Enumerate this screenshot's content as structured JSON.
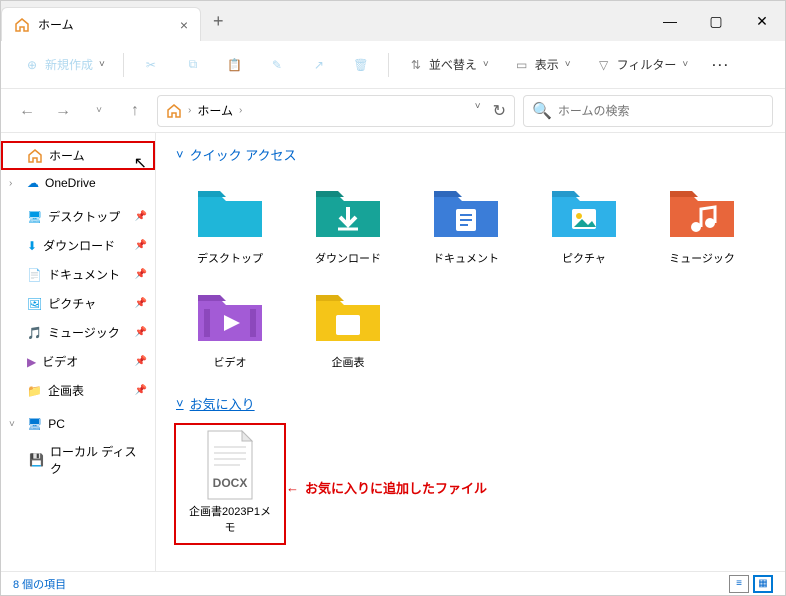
{
  "tab": {
    "title": "ホーム"
  },
  "toolbar": {
    "new": "新規作成",
    "sort": "並べ替え",
    "view": "表示",
    "filter": "フィルター"
  },
  "breadcrumb": {
    "root": "ホーム"
  },
  "search": {
    "placeholder": "ホームの検索"
  },
  "sidebar": {
    "home": "ホーム",
    "onedrive": "OneDrive",
    "desktop": "デスクトップ",
    "downloads": "ダウンロード",
    "documents": "ドキュメント",
    "pictures": "ピクチャ",
    "music": "ミュージック",
    "videos": "ビデオ",
    "plans": "企画表",
    "pc": "PC",
    "localdisk": "ローカル ディスク"
  },
  "sections": {
    "quick_access": "クイック アクセス",
    "favorites": "お気に入り"
  },
  "quick_items": [
    {
      "label": "デスクトップ"
    },
    {
      "label": "ダウンロード"
    },
    {
      "label": "ドキュメント"
    },
    {
      "label": "ピクチャ"
    },
    {
      "label": "ミュージック"
    },
    {
      "label": "ビデオ"
    },
    {
      "label": "企画表"
    }
  ],
  "fav_items": [
    {
      "label": "企画書2023P1メモ",
      "badge": "DOCX"
    }
  ],
  "annotation": {
    "arrow": "←",
    "text": "お気に入りに追加したファイル"
  },
  "status": {
    "text": "8 個の項目"
  }
}
